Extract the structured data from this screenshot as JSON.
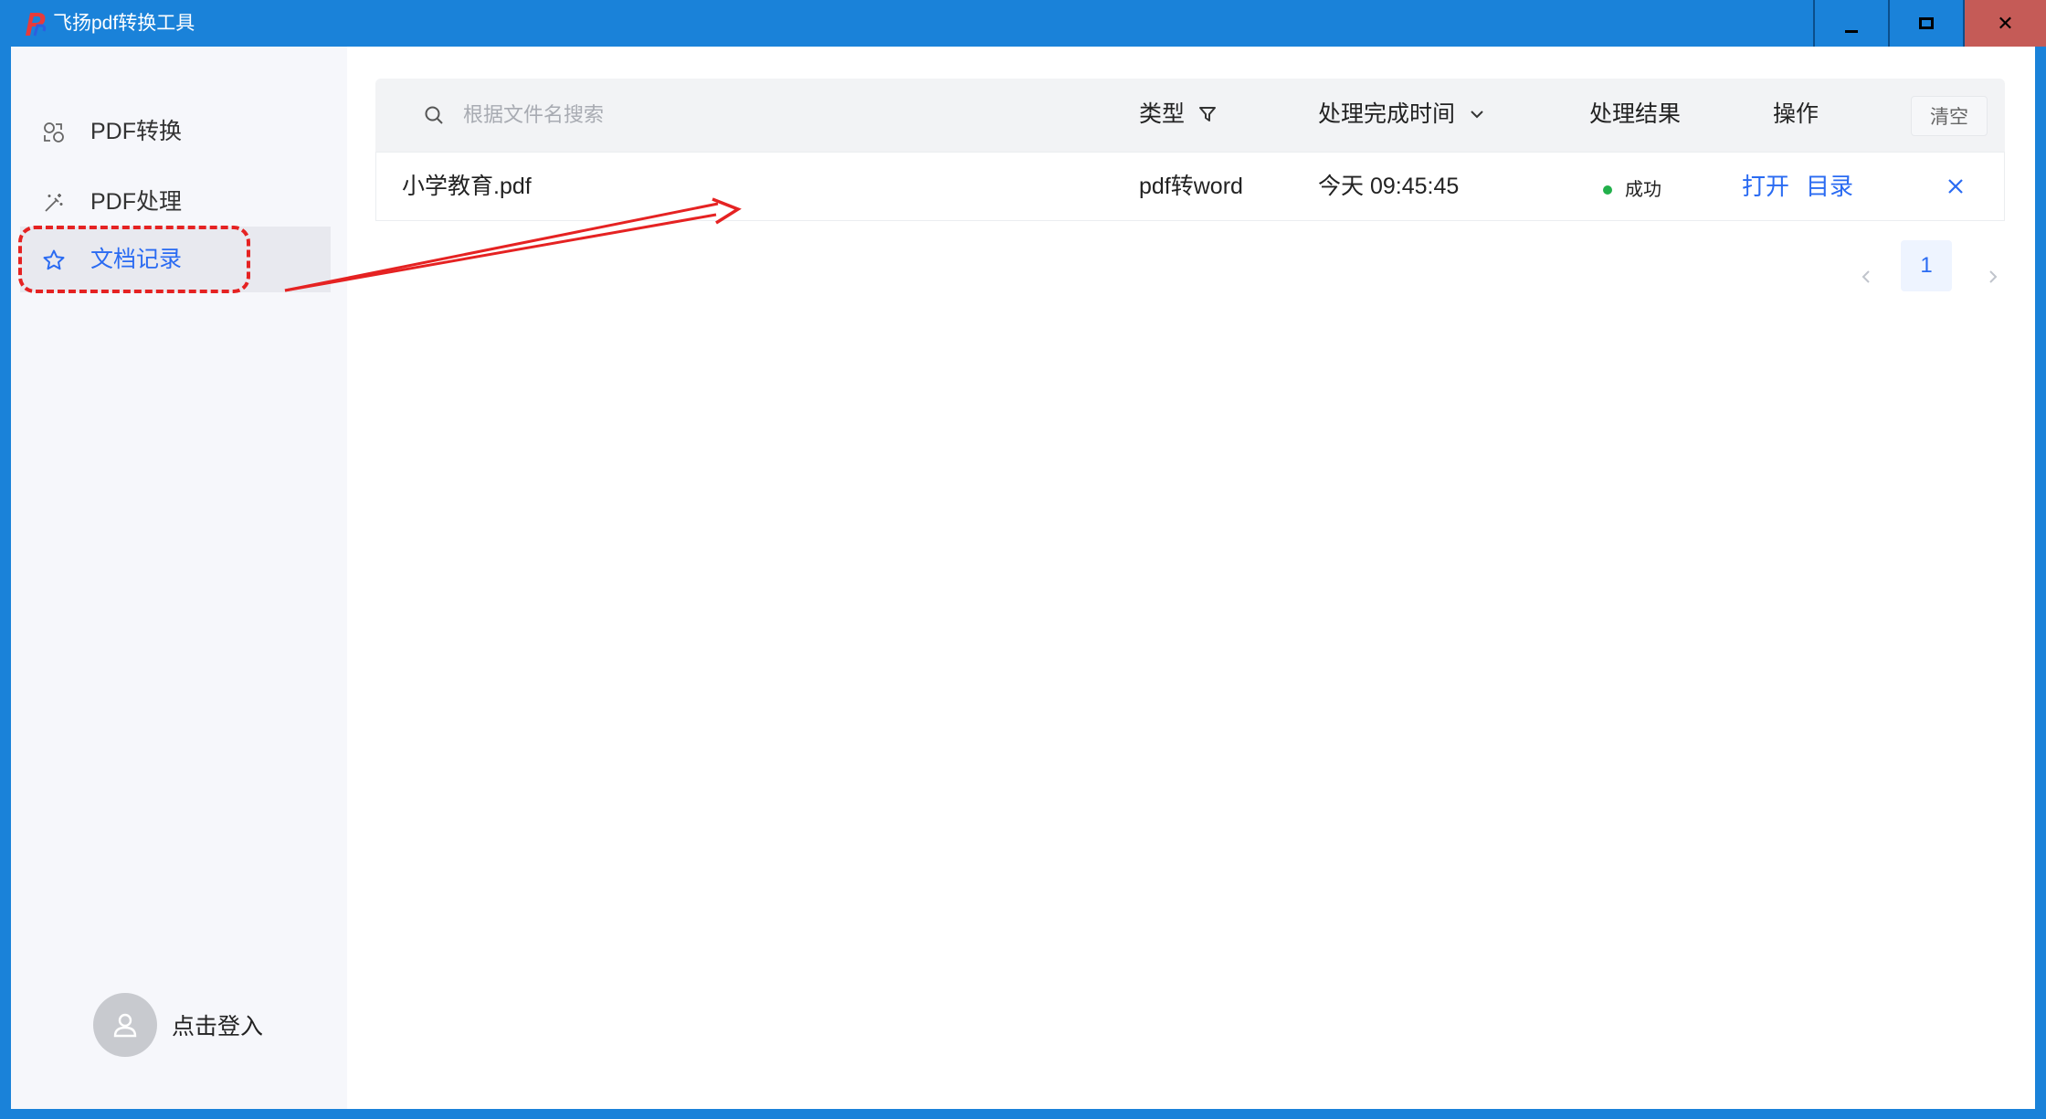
{
  "window": {
    "title": "飞扬pdf转换工具",
    "controls": {
      "minimize": "minimize-icon",
      "maximize": "maximize-icon",
      "close": "✕"
    }
  },
  "sidebar": {
    "items": [
      {
        "label": "PDF转换",
        "icon": "convert-icon",
        "active": false
      },
      {
        "label": "PDF处理",
        "icon": "magic-wand-icon",
        "active": false
      },
      {
        "label": "文档记录",
        "icon": "star-icon",
        "active": true
      }
    ],
    "login": {
      "label": "点击登入",
      "icon": "user-icon"
    }
  },
  "search": {
    "placeholder": "根据文件名搜索",
    "value": ""
  },
  "table": {
    "headers": {
      "type": "类型",
      "time": "处理完成时间",
      "result": "处理结果",
      "action": "操作"
    },
    "clear_label": "清空",
    "rows": [
      {
        "name": "小学教育.pdf",
        "type": "pdf转word",
        "time": "今天 09:45:45",
        "result": "成功",
        "open_label": "打开",
        "dir_label": "目录"
      }
    ]
  },
  "pagination": {
    "current": "1"
  },
  "colors": {
    "titlebar": "#1a82d9",
    "accent": "#2a6bf2",
    "success": "#22b04b",
    "annotation": "#e52222",
    "close_button": "#c55b57"
  }
}
